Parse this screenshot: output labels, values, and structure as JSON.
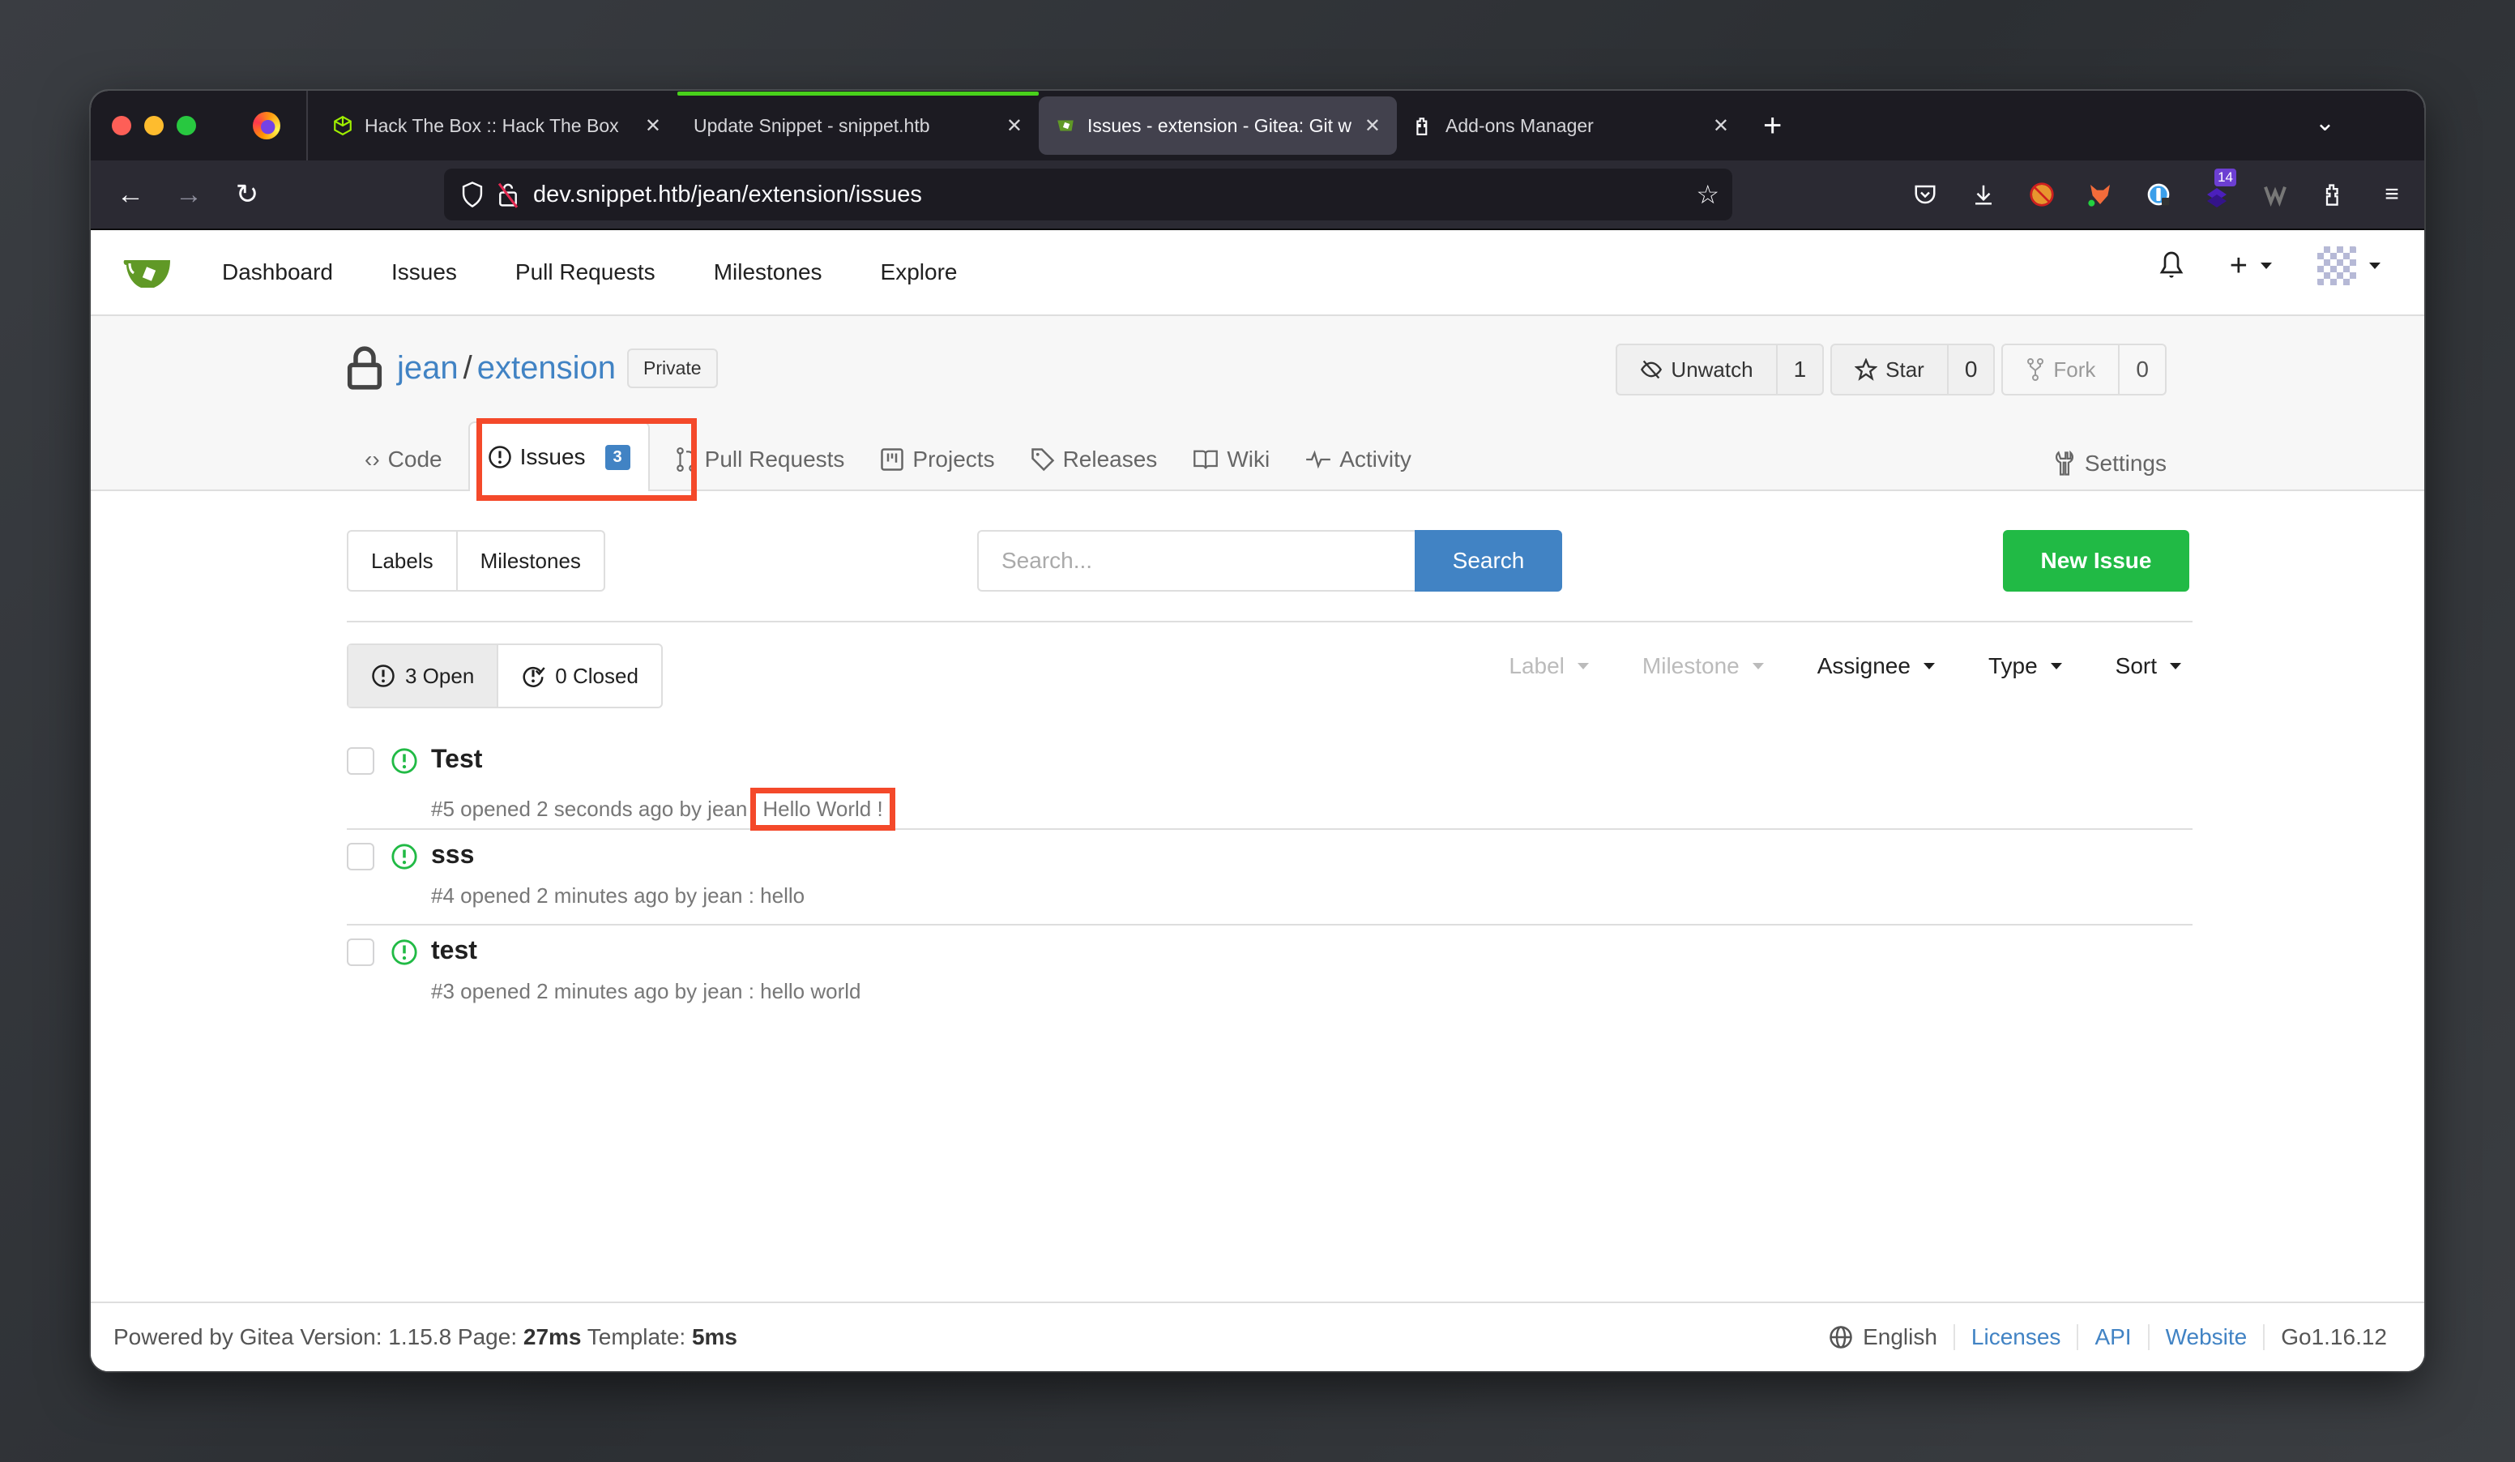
{
  "browser": {
    "tabs": [
      {
        "title": "Hack The Box :: Hack The Box",
        "icon": "htb-cube-icon",
        "active": false
      },
      {
        "title": "Update Snippet - snippet.htb",
        "icon": "none",
        "active": false,
        "loading": true
      },
      {
        "title": "Issues - extension - Gitea: Git w",
        "icon": "gitea-icon",
        "active": true
      },
      {
        "title": "Add-ons Manager",
        "icon": "puzzle-icon",
        "active": false
      }
    ],
    "url": "dev.snippet.htb/jean/extension/issues",
    "extension_badge": "14"
  },
  "gitea_nav": {
    "items": [
      "Dashboard",
      "Issues",
      "Pull Requests",
      "Milestones",
      "Explore"
    ]
  },
  "repo": {
    "owner": "jean",
    "separator": "/",
    "name": "extension",
    "visibility": "Private",
    "watch": {
      "label": "Unwatch",
      "count": "1"
    },
    "star": {
      "label": "Star",
      "count": "0"
    },
    "fork": {
      "label": "Fork",
      "count": "0"
    },
    "tabs": [
      {
        "label": "Code",
        "icon": "code-icon"
      },
      {
        "label": "Issues",
        "icon": "issue-opened-icon",
        "count": "3",
        "active": true
      },
      {
        "label": "Pull Requests",
        "icon": "git-pull-request-icon"
      },
      {
        "label": "Projects",
        "icon": "project-icon"
      },
      {
        "label": "Releases",
        "icon": "tag-icon"
      },
      {
        "label": "Wiki",
        "icon": "book-icon"
      },
      {
        "label": "Activity",
        "icon": "pulse-icon"
      }
    ],
    "settings_label": "Settings"
  },
  "issues_page": {
    "labels_btn": "Labels",
    "milestones_btn": "Milestones",
    "search_placeholder": "Search...",
    "search_btn": "Search",
    "new_issue_btn": "New Issue",
    "open_label": "3 Open",
    "closed_label": "0 Closed",
    "filters": [
      {
        "label": "Label",
        "disabled": true
      },
      {
        "label": "Milestone",
        "disabled": true
      },
      {
        "label": "Assignee",
        "disabled": false
      },
      {
        "label": "Type",
        "disabled": false
      },
      {
        "label": "Sort",
        "disabled": false
      }
    ],
    "issues": [
      {
        "title": "Test",
        "meta": "#5 opened 2 seconds ago by jean",
        "extra": "Hello World !",
        "highlighted": true
      },
      {
        "title": "sss",
        "meta": "#4 opened 2 minutes ago by jean : hello",
        "extra": ""
      },
      {
        "title": "test",
        "meta": "#3 opened 2 minutes ago by jean : hello world",
        "extra": ""
      }
    ]
  },
  "footer": {
    "powered": "Powered by Gitea Version: 1.15.8 Page: ",
    "page_time": "27ms",
    "template_label": " Template: ",
    "template_time": "5ms",
    "language": "English",
    "links": [
      "Licenses",
      "API",
      "Website"
    ],
    "go_version": "Go1.16.12"
  },
  "colors": {
    "accent_blue": "#4183c4",
    "new_issue_green": "#21ba45",
    "open_issue_green": "#21ba45",
    "highlight_red": "#f4492a"
  }
}
